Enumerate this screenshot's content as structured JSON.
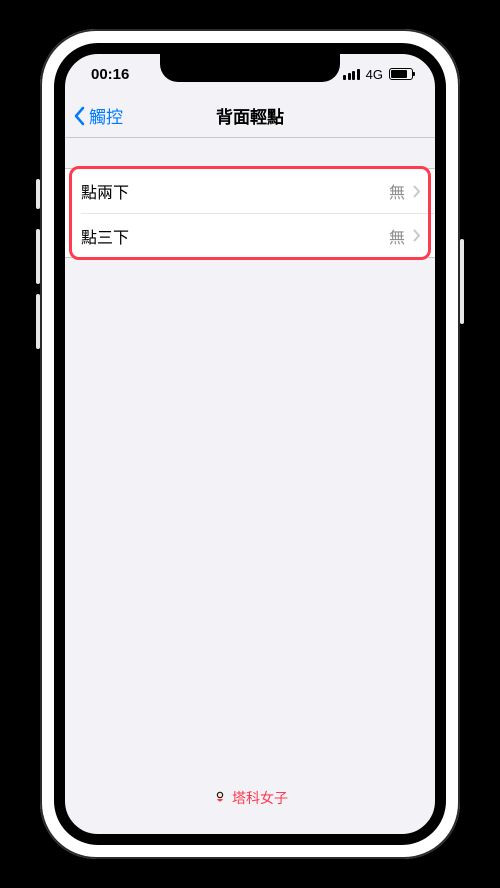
{
  "status": {
    "time": "00:16",
    "network": "4G"
  },
  "nav": {
    "back_label": "觸控",
    "title": "背面輕點"
  },
  "rows": [
    {
      "label": "點兩下",
      "value": "無"
    },
    {
      "label": "點三下",
      "value": "無"
    }
  ],
  "footer": {
    "brand": "塔科女子"
  }
}
